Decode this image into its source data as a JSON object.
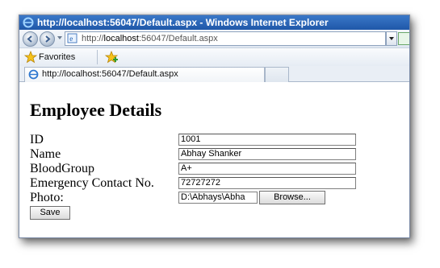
{
  "window": {
    "title": "http://localhost:56047/Default.aspx - Windows Internet Explorer"
  },
  "navbar": {
    "address_prefix": "http://",
    "address_host": "localhost",
    "address_rest": ":56047/Default.aspx"
  },
  "favorites": {
    "label": "Favorites"
  },
  "tabs": [
    {
      "label": "http://localhost:56047/Default.aspx"
    }
  ],
  "form": {
    "heading": "Employee Details",
    "fields": [
      {
        "label": "ID",
        "value": "1001"
      },
      {
        "label": "Name",
        "value": "Abhay Shanker"
      },
      {
        "label": "BloodGroup",
        "value": "A+"
      },
      {
        "label": "Emergency Contact No.",
        "value": "72727272"
      }
    ],
    "photo_label": "Photo:",
    "photo_path": "D:\\Abhays\\Abha",
    "browse_label": "Browse...",
    "save_label": "Save"
  },
  "colors": {
    "titlebar": "#2a64b5",
    "title_text": "#ffffff"
  },
  "icons": [
    "ie-icon",
    "back-icon",
    "forward-icon",
    "page-icon",
    "favorites-star-icon",
    "add-favorite-icon",
    "compatibility-icon"
  ]
}
